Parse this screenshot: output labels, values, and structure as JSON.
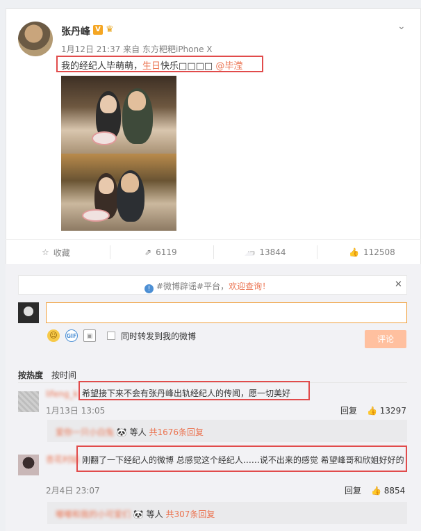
{
  "post": {
    "author": "张丹峰",
    "verified_badge": "V",
    "meta_date": "1月12日 21:37",
    "meta_from": "来自",
    "meta_source": "东方粑粑iPhone X",
    "text_pre": "我的经纪人毕萌萌，",
    "text_hl": "生日",
    "text_post": "快乐□□□□",
    "mention": "@毕滢",
    "icons": {
      "menu": "chevron-down-icon",
      "badge": "crown-icon"
    }
  },
  "actions": {
    "favorite": "收藏",
    "repost_count": "6119",
    "comment_count": "13844",
    "like_count": "112508"
  },
  "notice": {
    "tag1": "#微博辟谣#平台，",
    "tag2": "欢迎查询！",
    "close": "✕"
  },
  "composer": {
    "placeholder": "",
    "repost_label": "同时转发到我的微博",
    "submit_label": "评论",
    "gif_label": "GIF"
  },
  "sort": {
    "hot": "按热度",
    "time": "按时间"
  },
  "comments": [
    {
      "user": "lifeng_k",
      "text": "希望接下来不会有张丹峰出轨经纪人的传闻，愿一切美好",
      "time": "1月13日 13:05",
      "reply_label": "回复",
      "likes": "13297",
      "replies_users": "爱你一只小白兔 ",
      "replies_suffix": "等人",
      "replies_count": "共1676条回复"
    },
    {
      "user": "杏花村姑",
      "text": "刚翻了一下经纪人的微博 总感觉这个经纪人……说不出来的感觉 希望峰哥和欣姐好好的",
      "time": "2月4日 23:07",
      "reply_label": "回复",
      "likes": "8854",
      "replies_users": "嘟嘟和我的小可爱们 ",
      "replies_suffix": "等人",
      "replies_count": "共307条回复"
    }
  ],
  "colors": {
    "accent": "#eb7350",
    "highlight_box": "#e14b4b",
    "link": "#4c8fd4"
  }
}
